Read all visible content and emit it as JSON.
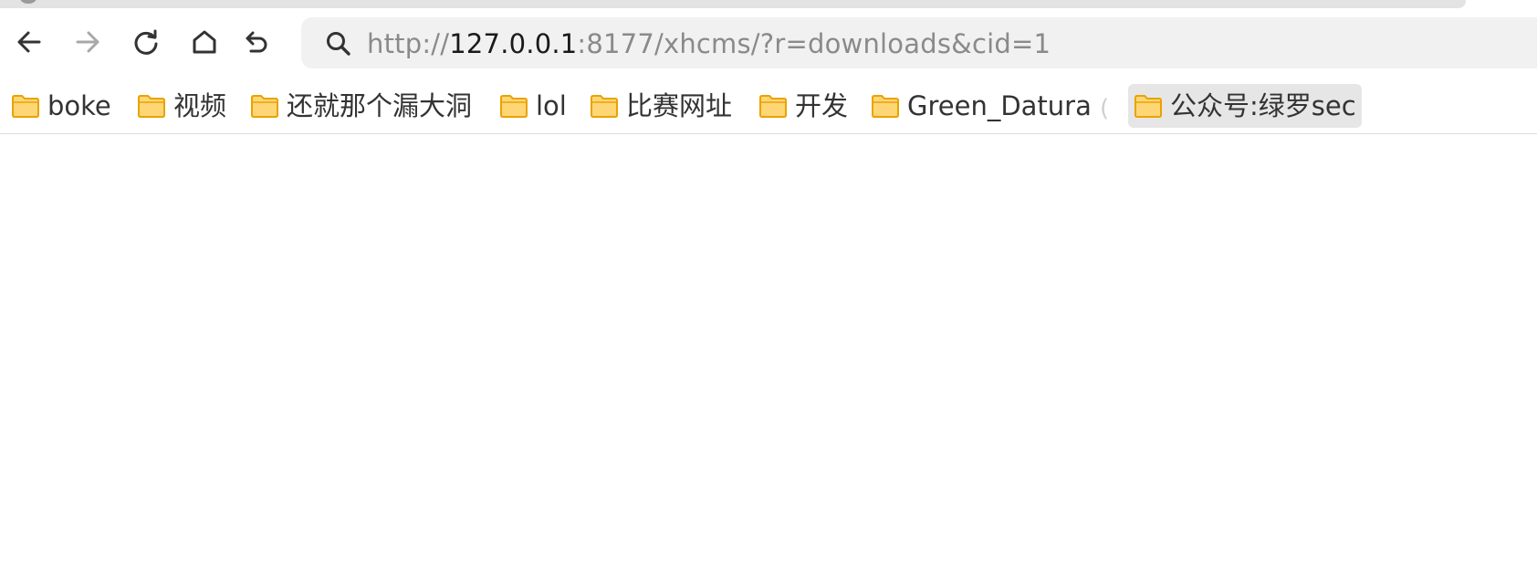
{
  "toolbar": {
    "back_icon": "arrow-left-icon",
    "forward_icon": "arrow-right-icon",
    "reload_icon": "reload-icon",
    "home_icon": "home-icon",
    "undo_icon": "undo-icon"
  },
  "address_bar": {
    "url_prefix": "http://",
    "url_host": "127.0.0.1",
    "url_rest": ":8177/xhcms/?r=downloads&cid=1",
    "search_icon": "search-icon"
  },
  "bookmarks": [
    {
      "label": "boke",
      "icon": "folder-icon"
    },
    {
      "label": "视频",
      "icon": "folder-icon"
    },
    {
      "label": "还就那个漏大洞",
      "icon": "folder-icon"
    },
    {
      "label": "lol",
      "icon": "folder-icon"
    },
    {
      "label": "比赛网址",
      "icon": "folder-icon"
    },
    {
      "label": "开发",
      "icon": "folder-icon"
    },
    {
      "label": "Green_Datura",
      "icon": "folder-icon"
    },
    {
      "label": "公众号:绿罗sec",
      "icon": "folder-icon",
      "active": true
    }
  ],
  "bookmarks_divider": "(",
  "colors": {
    "folder_fill": "#FFD675",
    "folder_stroke": "#E9A300",
    "address_bg": "#F1F1F1",
    "active_bookmark_bg": "#E6E6E6"
  }
}
